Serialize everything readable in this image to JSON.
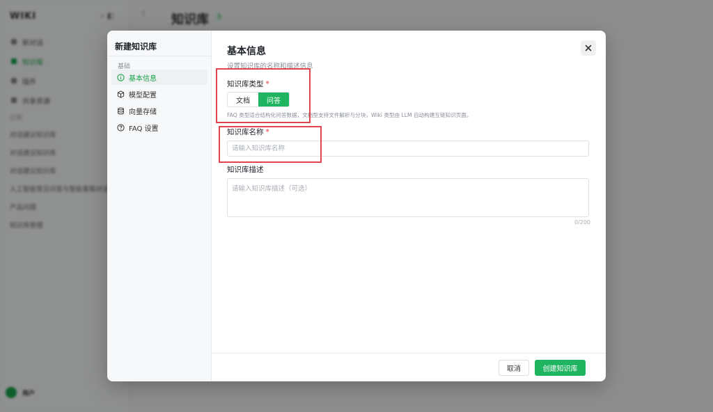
{
  "background": {
    "logo": "WIKI",
    "nav_items": [
      "新对话",
      "知识库",
      "插件",
      "共享资源"
    ],
    "active_nav_index": 1,
    "section_label": "近期",
    "recent_items": [
      "对话建议知识库",
      "对话建议知识库",
      "对话建议知识库",
      "人工智能常见问答与智能客服对话示例",
      "产品问题",
      "知识库管理"
    ],
    "page_title": "知识库",
    "page_count": "3",
    "user_name": "用户",
    "user_sub": ""
  },
  "modal": {
    "title": "新建知识库",
    "group_label": "基础",
    "nav": [
      {
        "label": "基本信息",
        "icon": "info-icon"
      },
      {
        "label": "模型配置",
        "icon": "cube-icon"
      },
      {
        "label": "向量存储",
        "icon": "database-icon"
      },
      {
        "label": "FAQ 设置",
        "icon": "question-icon"
      }
    ],
    "section_title": "基本信息",
    "section_subtitle": "设置知识库的名称和描述信息",
    "type_label": "知识库类型",
    "type_options": [
      "文档",
      "问答"
    ],
    "type_selected": "问答",
    "type_help": "FAQ 类型适合结构化问答数据，文档型支持文件解析与分块，Wiki 类型由 LLM 自动构建互链知识页面。",
    "name_label": "知识库名称",
    "name_placeholder": "请输入知识库名称",
    "name_value": "",
    "desc_label": "知识库描述",
    "desc_placeholder": "请输入知识库描述（可选）",
    "desc_value": "",
    "desc_counter": "0/200",
    "required_mark": "*",
    "cancel_label": "取消",
    "create_label": "创建知识库"
  },
  "colors": {
    "accent": "#1fb560",
    "highlight": "#e0454d"
  }
}
